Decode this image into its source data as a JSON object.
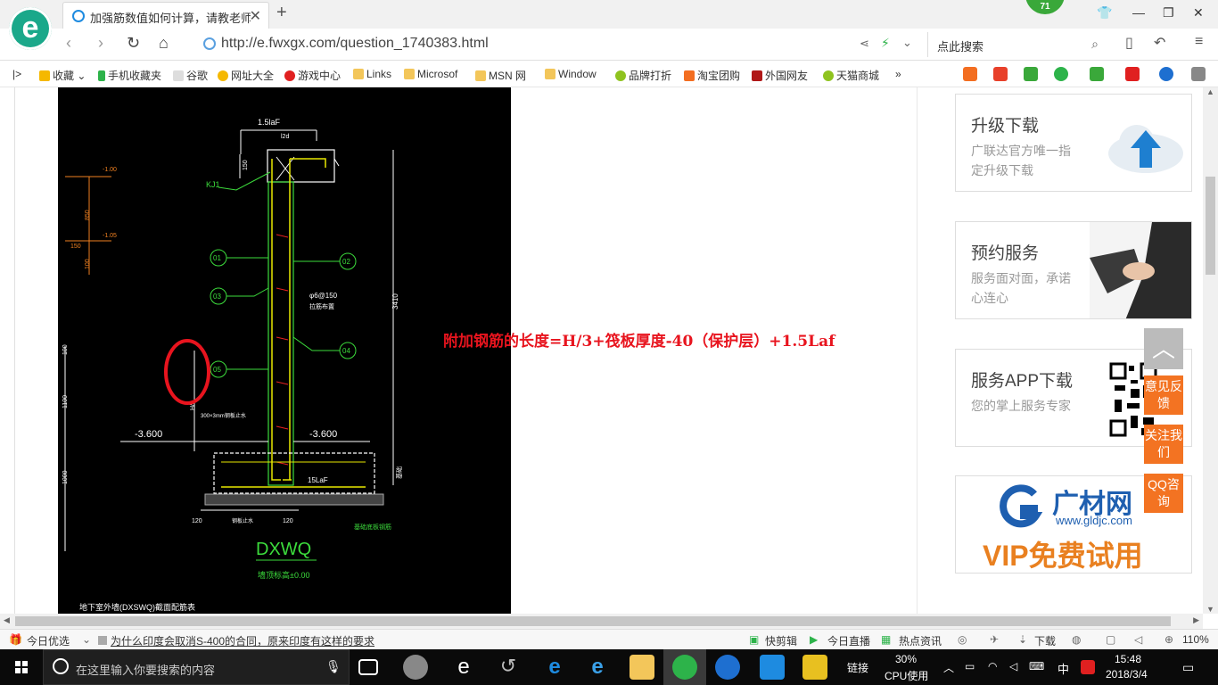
{
  "tab": {
    "title": "加强筋数值如何计算，请教老师。"
  },
  "badge": "71",
  "address": {
    "url": "http://e.fwxgx.com/question_1740383.html",
    "search_placeholder": "点此搜索"
  },
  "bookmarks": [
    "收藏",
    "手机收藏夹",
    "谷歌",
    "网址大全",
    "游戏中心",
    "Links",
    "Microsof",
    "MSN 网",
    "Window",
    "品牌打折",
    "淘宝团购",
    "外国网友",
    "天猫商城"
  ],
  "cad": {
    "labels": {
      "top_dim": "1.5laF",
      "small_dim": "l2d",
      "kj": "KJ1",
      "lev1": "-1.00",
      "lev2": "-1.05",
      "d850": "850",
      "d150": "150",
      "d100": "100",
      "c1": "01",
      "c2": "02",
      "c3": "03",
      "c4": "04",
      "c5": "05",
      "rebar": "φ6@150",
      "rebar_note": "拉筋布置",
      "h3": "H/3",
      "note_300": "300×3mm钢板止水",
      "elev_left": "-3.600",
      "elev_right": "-3.600",
      "d3410": "3410",
      "d1100": "1100",
      "d1000": "1000",
      "d100b": "100",
      "bottom_dim": "15LaF",
      "d120a": "120",
      "d120b": "120",
      "base_note": "基础底板钢筋",
      "steel_note": "钢板止水",
      "wall_id": "DXWQ",
      "wall_sub": "墙顶标高±0.00",
      "caption": "地下室外墙(DXSWQ)截面配筋表",
      "side_note": "基础"
    }
  },
  "annotation": "附加钢筋的长度=H/3+筏板厚度-40（保护层）+1.5Laf",
  "cards": [
    {
      "title": "升级下载",
      "desc": "广联达官方唯一指定升级下载"
    },
    {
      "title": "预约服务",
      "desc": "服务面对面，承诺心连心"
    },
    {
      "title": "服务APP下载",
      "desc": "您的掌上服务专家"
    },
    {
      "logo_name": "广材网",
      "logo_url": "www.gldjc.com",
      "promo": "VIP免费试用"
    }
  ],
  "float_buttons": [
    "意见反馈",
    "关注我们",
    "QQ咨询"
  ],
  "statusbar": {
    "left": "今日优选",
    "news": "为什么印度会取消S-400的合同，原来印度有这样的要求",
    "items": [
      "快剪辑",
      "今日直播",
      "热点资讯",
      "下载"
    ],
    "zoom": "110%"
  },
  "taskbar": {
    "search_placeholder": "在这里输入你要搜索的内容",
    "links": "链接",
    "cpu_pct": "30%",
    "cpu_label": "CPU使用",
    "ime": "中",
    "time": "15:48",
    "date": "2018/3/4"
  }
}
